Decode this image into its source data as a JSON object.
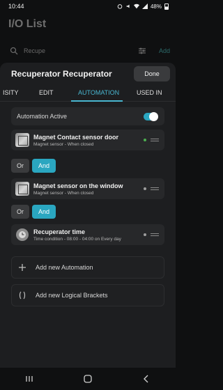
{
  "status_bar": {
    "time": "10:44",
    "battery": "48%"
  },
  "page": {
    "title": "I/O List"
  },
  "search": {
    "value": "Recupe",
    "add_label": "Add"
  },
  "sheet": {
    "title": "Recuperator Recuperator",
    "done_label": "Done",
    "tabs": [
      {
        "label": "ISITY"
      },
      {
        "label": "EDIT"
      },
      {
        "label": "AUTOMATION"
      },
      {
        "label": "USED IN"
      }
    ],
    "active_tab": "AUTOMATION"
  },
  "automation": {
    "active_label": "Automation Active",
    "active": true,
    "conditions": [
      {
        "title": "Magnet Contact sensor door",
        "subtitle": "Magnet sensor - When closed",
        "status_color": "#4caf50"
      },
      {
        "title": "Magnet sensor on the window",
        "subtitle": "Magnet sensor - When closed",
        "status_color": "#9e9e9e"
      },
      {
        "title": "Recuperator time",
        "subtitle": "Time condition - 08:00 - 04:00 on Every day",
        "status_color": "#9e9e9e"
      }
    ],
    "logic": [
      {
        "or_label": "Or",
        "and_label": "And",
        "selected": "And"
      },
      {
        "or_label": "Or",
        "and_label": "And",
        "selected": "And"
      }
    ],
    "add_automation_label": "Add new Automation",
    "add_brackets_label": "Add new Logical Brackets"
  },
  "colors": {
    "accent": "#2aa6c0",
    "tab_active": "#49b6d0",
    "background": "#0f1011",
    "sheet": "#1d1e20"
  },
  "icons": [
    "wifi-icon",
    "signal-icon",
    "battery-icon",
    "search-icon",
    "filter-icon",
    "clock-icon",
    "plus-icon",
    "brackets-icon",
    "recents-icon",
    "home-icon",
    "back-icon"
  ]
}
